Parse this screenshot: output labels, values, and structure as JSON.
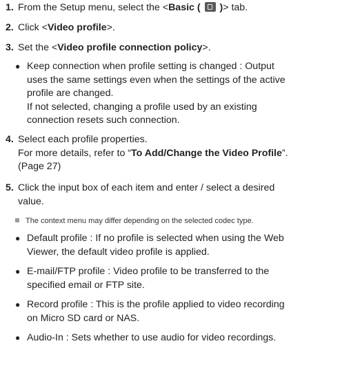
{
  "steps": [
    {
      "num": "1.",
      "pre": "From the Setup menu, select the <",
      "bold": "Basic (",
      "icon": "basic-setup-icon",
      "bold_after": ")",
      "post": "> tab."
    },
    {
      "num": "2.",
      "pre": "Click <",
      "bold": "Video profile",
      "post": ">."
    },
    {
      "num": "3.",
      "pre": "Set the <",
      "bold": "Video profile connection policy",
      "post": ">."
    },
    {
      "num": "4.",
      "line1": "Select each profile properties.",
      "line2_pre": "For more details, refer to “",
      "line2_bold": "To Add/Change the Video Profile",
      "line2_post": "”.",
      "line3": "(Page 27)"
    },
    {
      "num": "5.",
      "line1": "Click the input box of each item and enter / select a desired",
      "line2": "value."
    }
  ],
  "policy_bullet": {
    "line1": "Keep connection when profile setting is changed : Output",
    "line2": "uses the same settings even when the settings of the active",
    "line3": "profile are changed.",
    "line4": "If not selected, changing a profile used by an existing",
    "line5": "connection resets such connection."
  },
  "note": "The context menu may differ depending on the selected codec type.",
  "profile_bullets": [
    {
      "line1": "Default profile : If no profile is selected when using the Web",
      "line2": "Viewer, the default video profile is applied."
    },
    {
      "line1": "E-mail/FTP profile : Video profile to be transferred to the",
      "line2": "specified email or FTP site."
    },
    {
      "line1": "Record profile : This is the profile applied to video recording",
      "line2": "on Micro SD card or NAS."
    },
    {
      "line1": "Audio-In : Sets whether to use audio for video recordings."
    }
  ]
}
